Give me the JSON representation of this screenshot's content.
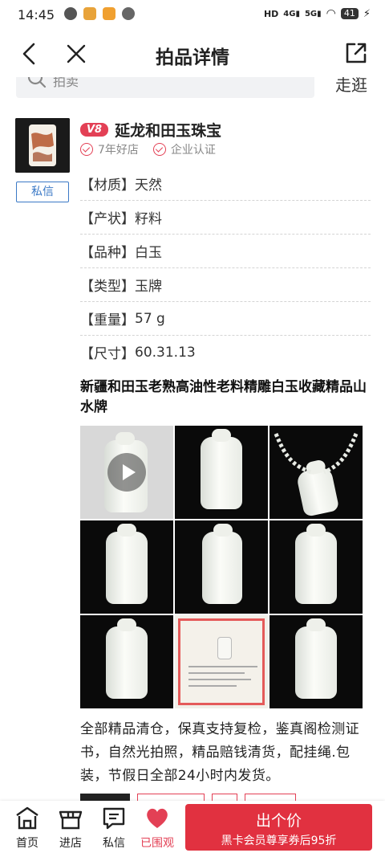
{
  "status_bar": {
    "time": "14:45",
    "battery": "41"
  },
  "header": {
    "title": "拍品详情"
  },
  "search": {
    "placeholder": "拍卖",
    "follow_label": "走逛"
  },
  "seller": {
    "level": "V8",
    "name": "延龙和田玉珠宝",
    "badges": [
      "7年好店",
      "企业认证"
    ],
    "message_label": "私信"
  },
  "attributes": [
    {
      "key": "【材质】",
      "value": "天然"
    },
    {
      "key": "【产状】",
      "value": "籽料"
    },
    {
      "key": "【品种】",
      "value": "白玉"
    },
    {
      "key": "【类型】",
      "value": "玉牌"
    },
    {
      "key": "【重量】",
      "value": "57 g"
    },
    {
      "key": "【尺寸】",
      "value": "60.31.13"
    }
  ],
  "item": {
    "title": "新疆和田玉老熟高油性老料精雕白玉收藏精品山水牌",
    "description": "全部精品清仓，保真支持复检，鉴真阁检测证书，自然光拍照，精品赔钱清货，配挂绳.包装，节假日全部24小时内发货。"
  },
  "bottom_nav": {
    "items": [
      {
        "label": "首页",
        "icon": "home-icon"
      },
      {
        "label": "进店",
        "icon": "shop-icon"
      },
      {
        "label": "私信",
        "icon": "message-icon"
      },
      {
        "label": "已围观",
        "icon": "heart-icon"
      }
    ],
    "bid_button": {
      "label": "出个价",
      "sub_label": "黑卡会员尊享券后95折"
    }
  },
  "colors": {
    "accent": "#e34055",
    "bid_button": "#e13140",
    "link": "#3b79c6"
  }
}
